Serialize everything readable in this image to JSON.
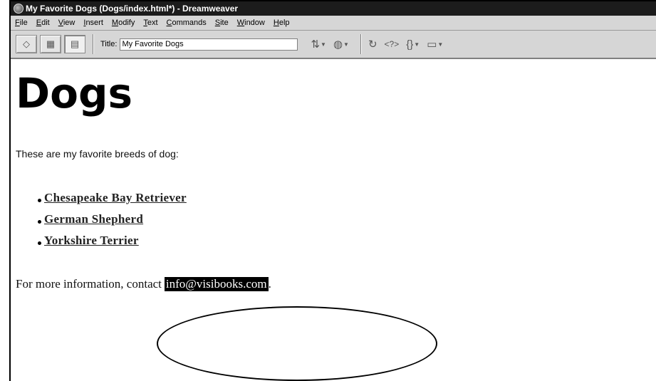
{
  "window": {
    "title": "My Favorite Dogs (Dogs/index.html*) - Dreamweaver"
  },
  "menubar": {
    "items": [
      "File",
      "Edit",
      "View",
      "Insert",
      "Modify",
      "Text",
      "Commands",
      "Site",
      "Window",
      "Help"
    ]
  },
  "toolbar": {
    "title_label": "Title:",
    "title_value": "My Favorite Dogs",
    "icons": [
      "code-view-icon",
      "split-view-icon",
      "design-view-icon",
      "file-management-icon",
      "preview-browser-icon",
      "refresh-icon",
      "reference-icon",
      "code-navigation-icon",
      "view-options-icon"
    ]
  },
  "document": {
    "heading": "Dogs",
    "intro": "These are my favorite breeds of dog:",
    "breeds": [
      "Chesapeake Bay Retriever",
      "German Shepherd",
      "Yorkshire Terrier"
    ],
    "contact_text": "For more information, contact",
    "email": "info@visibooks.com",
    "contact_suffix": "."
  },
  "colors": {
    "titlebar_bg": "#1c1c1c",
    "chrome_bg": "#d6d6d6",
    "selection_bg": "#000000"
  }
}
